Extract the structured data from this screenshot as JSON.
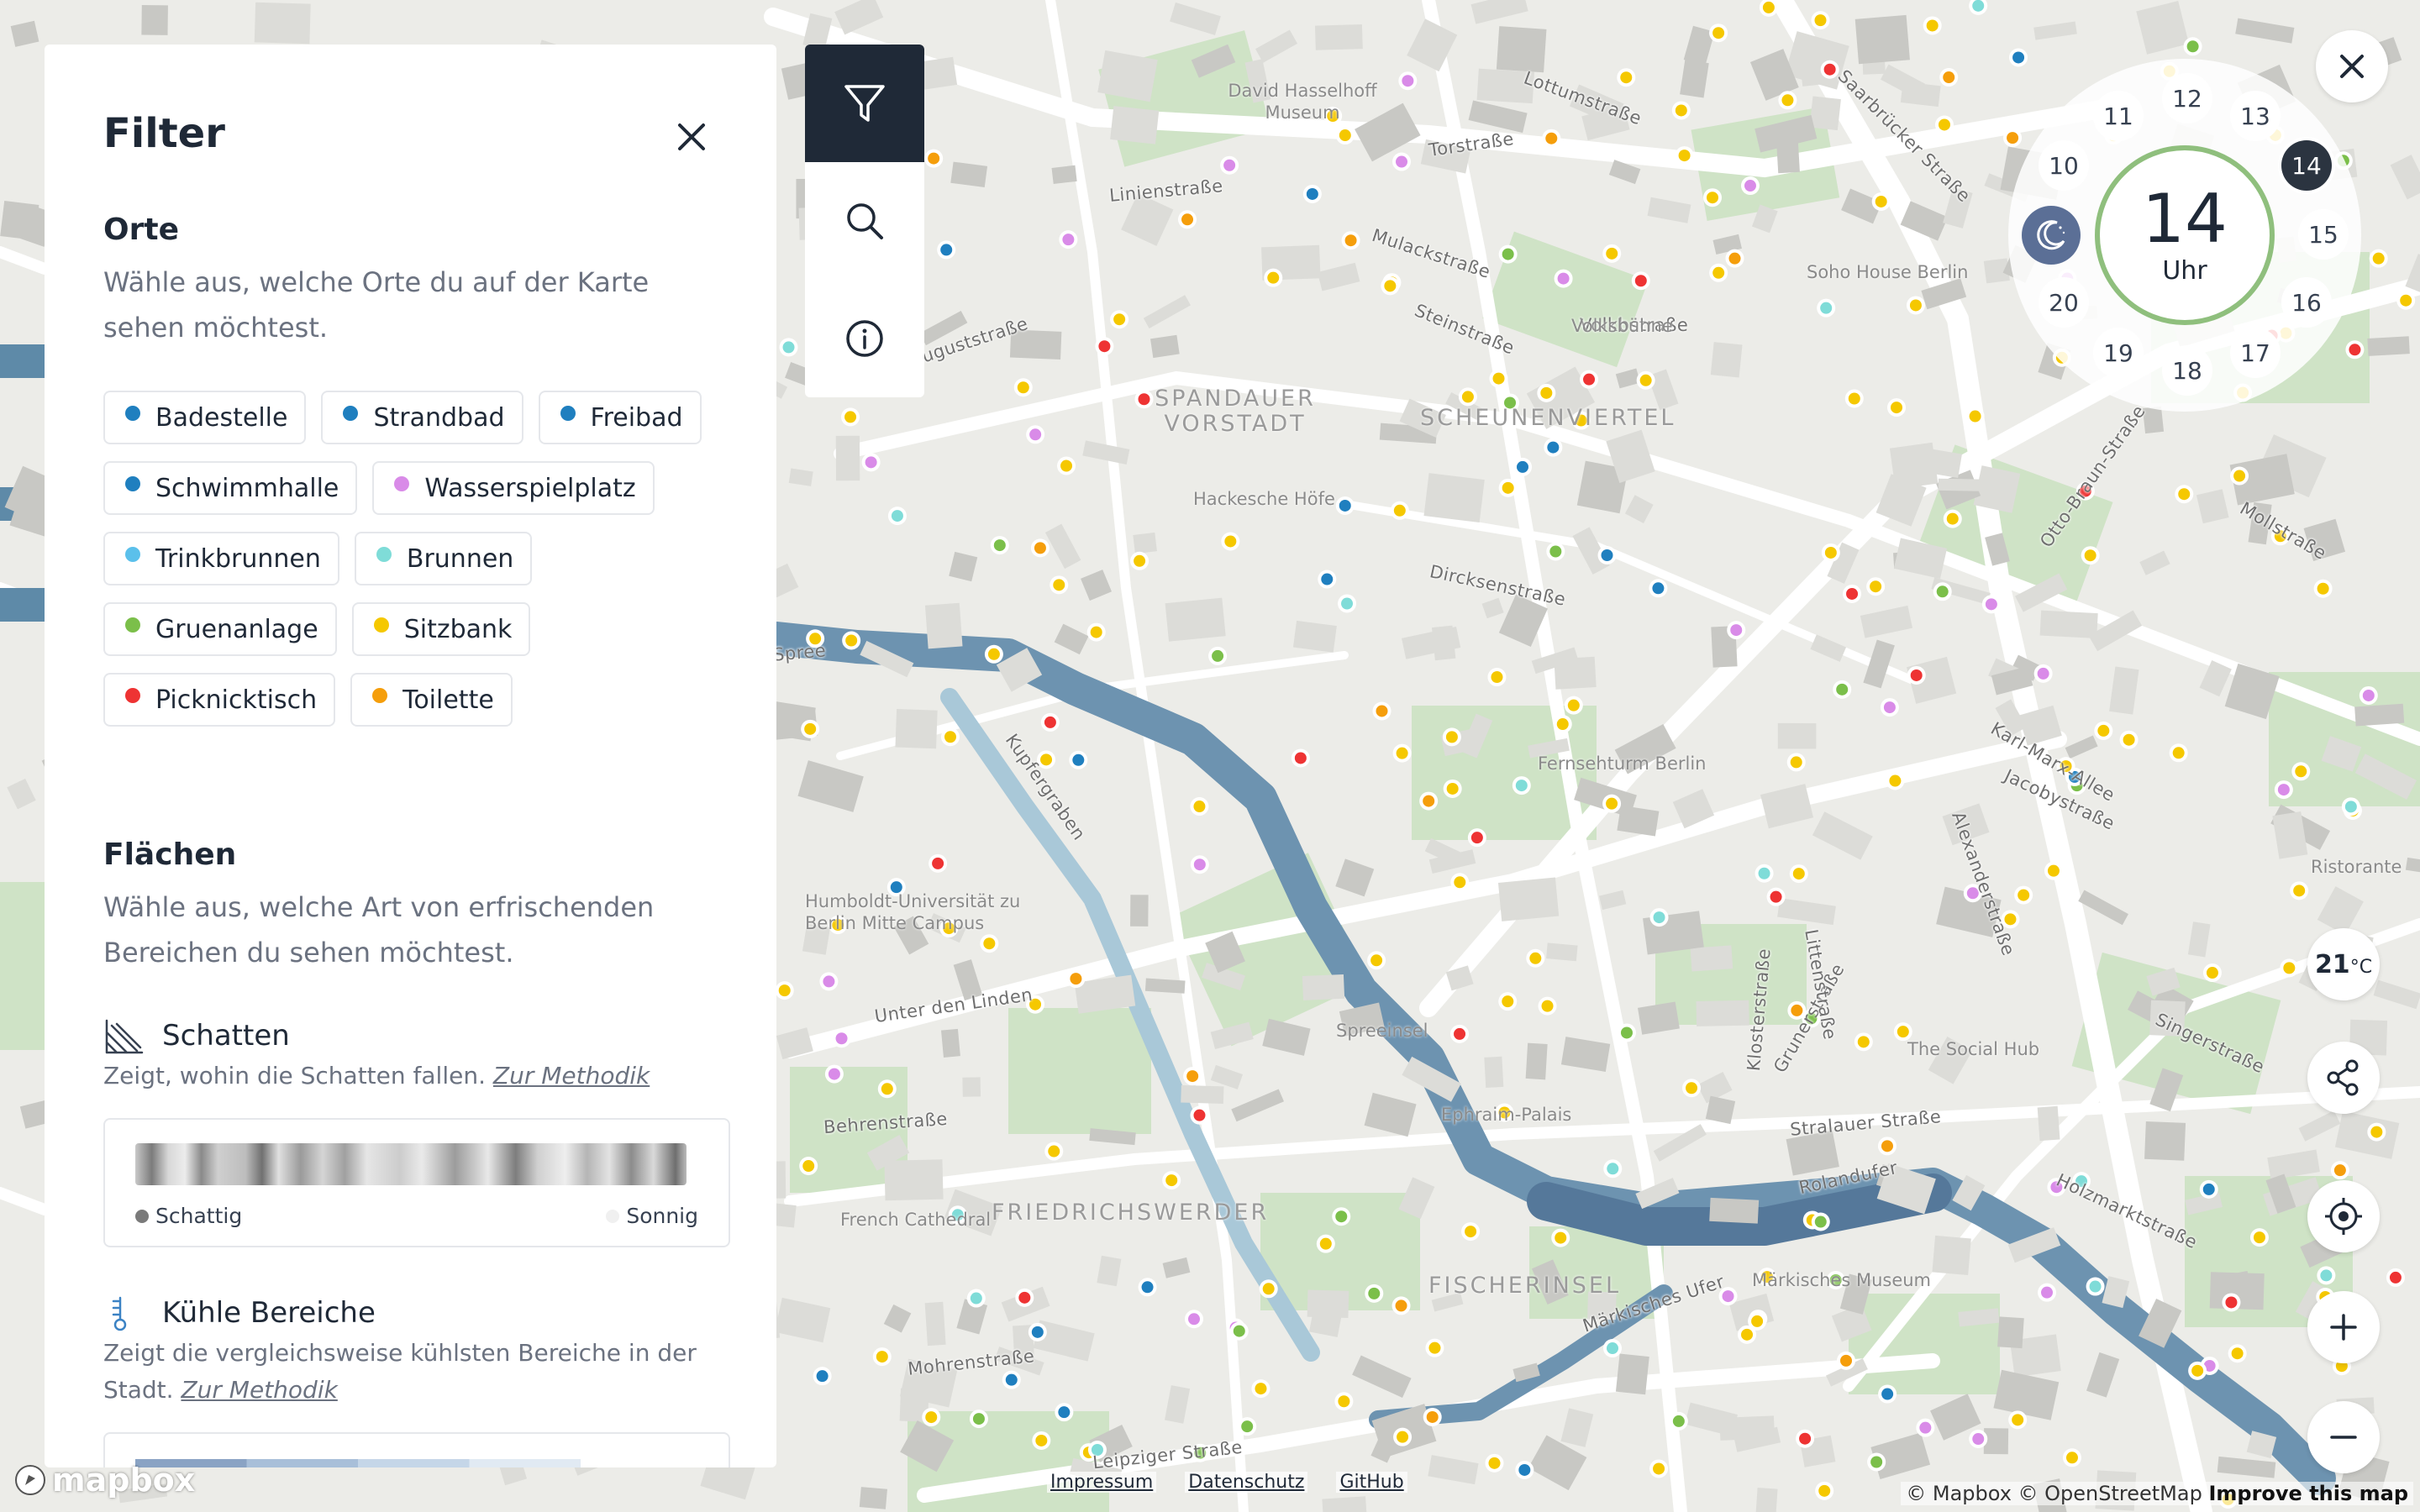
{
  "filter": {
    "title": "Filter",
    "orte": {
      "title": "Orte",
      "description": "Wähle aus, welche Orte du auf der Karte sehen möchtest.",
      "chips": [
        [
          {
            "label": "Badestelle",
            "color": "#1f7fbf"
          },
          {
            "label": "Strandbad",
            "color": "#1f7fbf"
          },
          {
            "label": "Freibad",
            "color": "#1f7fbf"
          }
        ],
        [
          {
            "label": "Schwimmhalle",
            "color": "#1f7fbf"
          },
          {
            "label": "Wasserspielplatz",
            "color": "#d98be8"
          }
        ],
        [
          {
            "label": "Trinkbrunnen",
            "color": "#5bc0eb"
          },
          {
            "label": "Brunnen",
            "color": "#7fdcd8"
          }
        ],
        [
          {
            "label": "Gruenanlage",
            "color": "#7bbf4a"
          },
          {
            "label": "Sitzbank",
            "color": "#f5c800"
          }
        ],
        [
          {
            "label": "Picknicktisch",
            "color": "#ee3333"
          },
          {
            "label": "Toilette",
            "color": "#f59e0b"
          }
        ]
      ]
    },
    "flaechen": {
      "title": "Flächen",
      "description": "Wähle aus, welche Art von erfrischenden Bereichen du sehen möchtest.",
      "schatten": {
        "title": "Schatten",
        "description": "Zeigt, wohin die Schatten fallen.",
        "link": "Zur Methodik",
        "legend_left": "Schattig",
        "legend_right": "Sonnig"
      },
      "kuehle": {
        "title": "Kühle Bereiche",
        "description": "Zeigt die vergleichsweise kühlsten Bereiche in der Stadt.",
        "link": "Zur Methodik"
      }
    }
  },
  "tabs": [
    "filter-icon",
    "search-icon",
    "info-icon"
  ],
  "time_dial": {
    "selected_hour": "14",
    "unit": "Uhr",
    "hours": [
      "10",
      "11",
      "12",
      "13",
      "14",
      "15",
      "16",
      "17",
      "18",
      "19",
      "20"
    ]
  },
  "weather": {
    "temperature": "21",
    "unit": "°C"
  },
  "map_labels": {
    "streets": [
      "Torstraße",
      "Linienstraße",
      "Mulackstraße",
      "Steinstraße",
      "Auguststraße",
      "Dircksenstraße",
      "Karl-Marx-Allee",
      "Alexanderstraße",
      "Grunerstraße",
      "Klosterstraße",
      "Littenstraße",
      "Stralauer Straße",
      "Holzmarktstraße",
      "Unter den Linden",
      "Behrenstraße",
      "Mohrenstraße",
      "Leipziger Straße",
      "Märkisches Ufer",
      "Rolandufer",
      "Otto-Braun-Straße",
      "Mollstraße",
      "Saarbrücker Straße",
      "Lottumstraße",
      "Singerstraße",
      "Jacobystraße",
      "Spree",
      "Kupfergraben",
      "Volkbstraße"
    ],
    "districts": [
      "SPANDAUER VORSTADT",
      "SCHEUNENVIERTEL",
      "FRIEDRICHSWERDER",
      "FISCHERINSEL"
    ],
    "pois": [
      "David Hasselhoff Museum",
      "Soho House Berlin",
      "Volksbühne",
      "Hackesche Höfe",
      "Fernsehturm Berlin",
      "Spreeinsel",
      "Ephraim-Palais",
      "Märkisches Museum",
      "The Social Hub",
      "Humboldt-Universität zu Berlin Mitte Campus",
      "French Cathedral",
      "Ristorante"
    ]
  },
  "footer": {
    "logo": "mapbox",
    "links": [
      "Impressum",
      "Datenschutz",
      "GitHub"
    ],
    "attribution_1": "© Mapbox © OpenStreetMap",
    "attribution_2": "Improve this map"
  }
}
